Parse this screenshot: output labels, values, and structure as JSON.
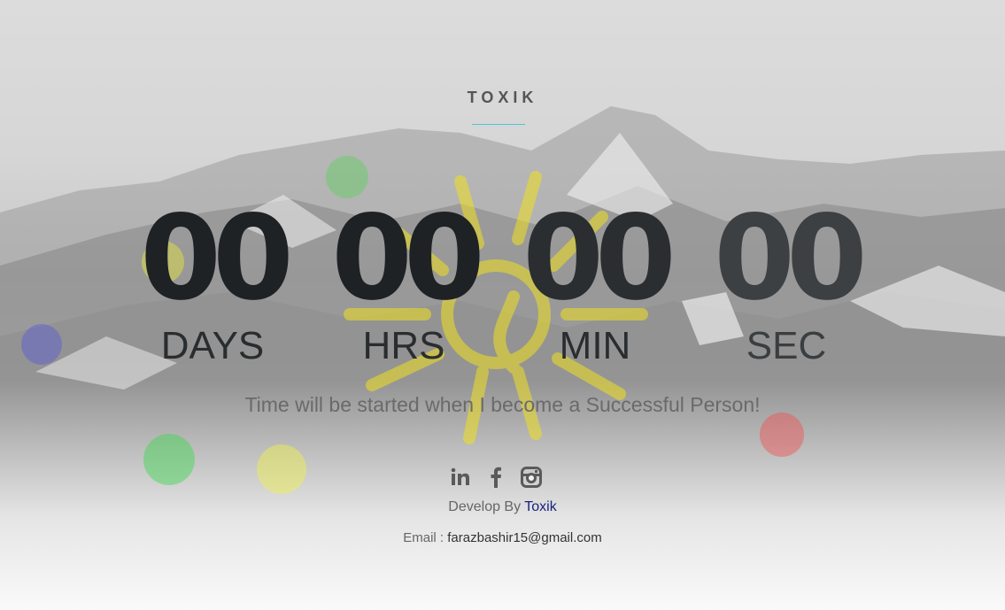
{
  "brand": {
    "name": "TOXIK",
    "accent_color": "#4fc3d9"
  },
  "countdown": [
    {
      "value": "00",
      "label": "DAYS"
    },
    {
      "value": "00",
      "label": "HRS"
    },
    {
      "value": "00",
      "label": "MIN"
    },
    {
      "value": "00",
      "label": "SEC"
    }
  ],
  "tagline": "Time will be started when I become a Successful Person!",
  "social": [
    {
      "icon": "linkedin-icon"
    },
    {
      "icon": "facebook-icon"
    },
    {
      "icon": "instagram-icon"
    }
  ],
  "footer": {
    "develop_prefix": "Develop By",
    "developer_name": "Toxik",
    "email_label": "Email :",
    "email_address": "farazbashir15@gmail.com"
  }
}
